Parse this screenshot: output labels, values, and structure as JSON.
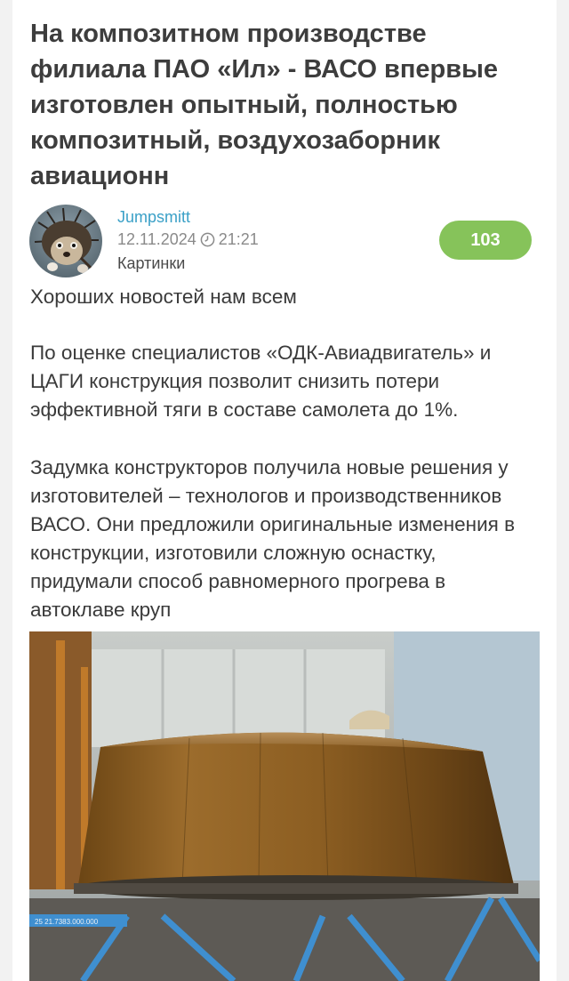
{
  "post": {
    "title": "На композитном производстве филиала ПАО «Ил» - ВАСО впервые изготовлен опытный, полностью композитный, воздухозаборник авиационн",
    "author": "Jumpsmitt",
    "date": "12.11.2024",
    "time": "21:21",
    "category": "Картинки",
    "score": "103",
    "paragraphs": [
      "Хороших новостей нам всем",
      "По оценке специалистов «ОДК-Авиадвигатель» и ЦАГИ конструкция позволит снизить потери эффективной тяги в составе самолета до 1%.",
      "Задумка конструкторов получила новые решения у изготовителей – технологов и производственников ВАСО. Они предложили оригинальные изменения в конструкции, изготовили сложную оснастку, придумали способ равномерного прогрева в автоклаве круп"
    ],
    "photo_label": "25 21.7383.000.000"
  },
  "icons": {
    "clock": "clock-icon",
    "avatar": "hedgehog-avatar"
  },
  "colors": {
    "author_link": "#3aa0c7",
    "score_badge": "#86c35a",
    "title_text": "#3d3d3d"
  }
}
